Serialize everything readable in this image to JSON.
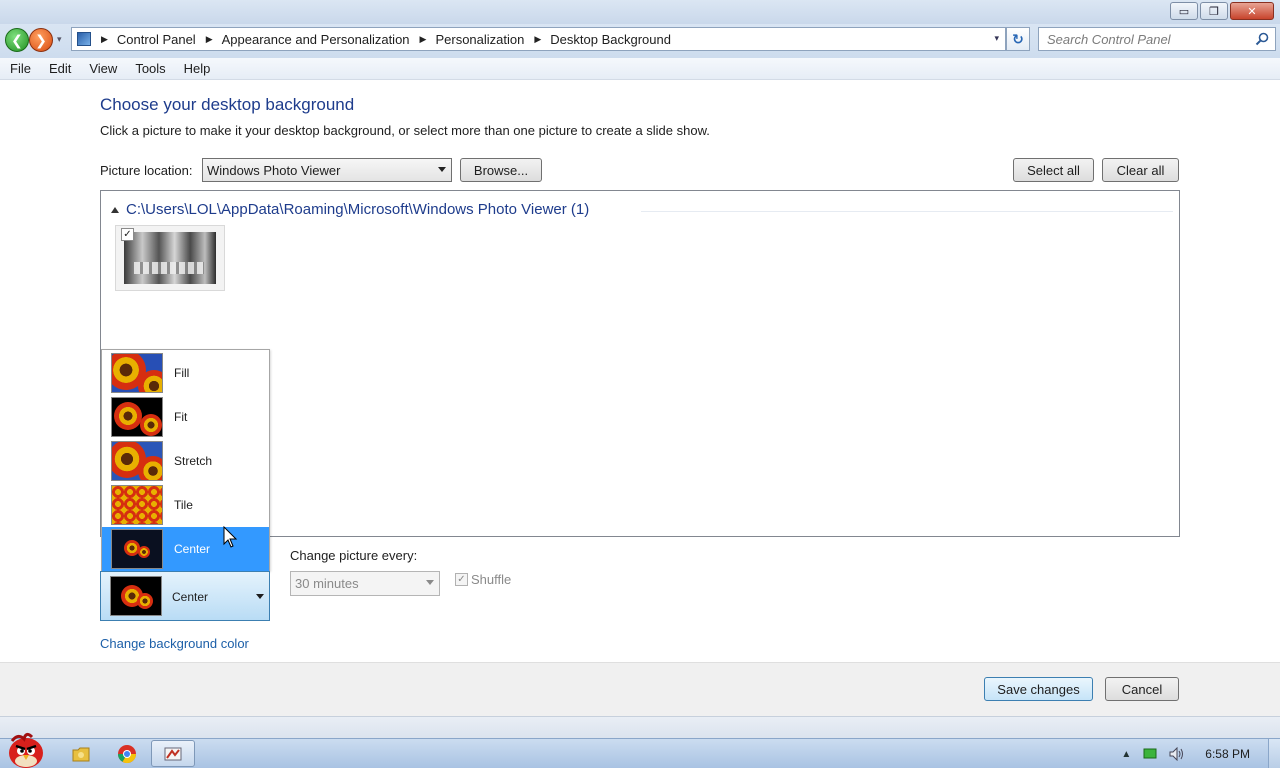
{
  "window": {
    "minimize_glyph": "▭",
    "maximize_glyph": "❐",
    "close_glyph": "✕"
  },
  "nav": {
    "back_glyph": "❮",
    "forward_glyph": "❯",
    "history_glyph": "▾",
    "breadcrumbs": [
      "Control Panel",
      "Appearance and Personalization",
      "Personalization",
      "Desktop Background"
    ],
    "refresh_glyph": "↻",
    "search_placeholder": "Search Control Panel"
  },
  "menu": {
    "items": [
      "File",
      "Edit",
      "View",
      "Tools",
      "Help"
    ]
  },
  "page": {
    "title": "Choose your desktop background",
    "description": "Click a picture to make it your desktop background, or select more than one picture to create a slide show.",
    "location_label": "Picture location:",
    "location_value": "Windows Photo Viewer",
    "browse_label": "Browse...",
    "select_all_label": "Select all",
    "clear_all_label": "Clear all",
    "group_path": "C:\\Users\\LOL\\AppData\\Roaming\\Microsoft\\Windows Photo Viewer (1)",
    "picture_checked": true,
    "check_glyph": "✓"
  },
  "picture_position": {
    "options": [
      "Fill",
      "Fit",
      "Stretch",
      "Tile",
      "Center"
    ],
    "highlighted": "Center",
    "selected": "Center"
  },
  "slideshow": {
    "change_label": "Change picture every:",
    "interval_value": "30 minutes",
    "shuffle_label": "Shuffle",
    "shuffle_checked": true,
    "enabled": false
  },
  "links": {
    "change_bg_color": "Change background color"
  },
  "buttons": {
    "save": "Save changes",
    "cancel": "Cancel"
  },
  "taskbar": {
    "clock": "6:58 PM",
    "tray_arrow": "▲"
  },
  "colors": {
    "accent_title": "#1e3c8c",
    "link": "#1c5fa8",
    "selection": "#3399ff"
  },
  "icons": {
    "back": "back-arrow-icon",
    "forward": "forward-arrow-icon",
    "control_panel": "control-panel-icon",
    "refresh": "refresh-icon",
    "search": "search-icon",
    "start": "angry-bird-start-icon",
    "explorer": "windows-explorer-icon",
    "chrome": "chrome-icon",
    "control_panel_task": "control-panel-task-icon",
    "network": "network-icon",
    "volume": "volume-icon"
  }
}
